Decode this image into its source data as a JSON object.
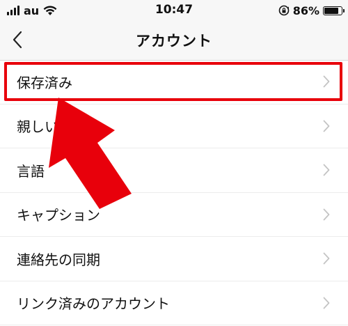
{
  "status_bar": {
    "carrier": "au",
    "time": "10:47",
    "battery": "86%",
    "battery_level": 0.86
  },
  "nav": {
    "title": "アカウント",
    "back_icon": "chevron-left-icon"
  },
  "menu": {
    "items": [
      {
        "label": "保存済み"
      },
      {
        "label": "親しい友達"
      },
      {
        "label": "言語"
      },
      {
        "label": "キャプション"
      },
      {
        "label": "連絡先の同期"
      },
      {
        "label": "リンク済みのアカウント"
      }
    ]
  },
  "colors": {
    "highlight": "#e8000b",
    "chevron": "#c4c4c4",
    "bar_bg": "#f7f7f7"
  }
}
